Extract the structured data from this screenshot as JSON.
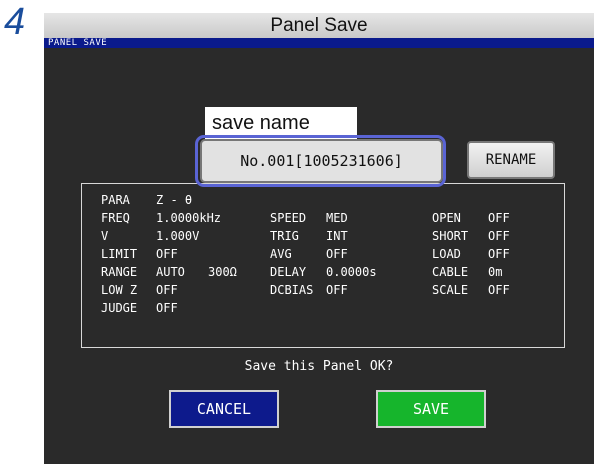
{
  "step_number": "4",
  "header_title": "Panel Save",
  "screen_title": "PANEL SAVE",
  "callout_label": "save name",
  "save_name": {
    "number": "No.001",
    "bracket_open": "[",
    "value": "1005231606",
    "bracket_close": "]"
  },
  "rename_label": "RENAME",
  "params": {
    "para": {
      "label": "PARA",
      "value": "Z - θ"
    },
    "freq": {
      "label": "FREQ",
      "value": "1.0000kHz"
    },
    "v": {
      "label": "V",
      "value": "1.000V"
    },
    "limit": {
      "label": "LIMIT",
      "value": "OFF"
    },
    "range": {
      "label": "RANGE",
      "value": "AUTO",
      "value2": "300Ω"
    },
    "lowz": {
      "label": "LOW Z",
      "value": "OFF"
    },
    "judge": {
      "label": "JUDGE",
      "value": "OFF"
    },
    "speed": {
      "label": "SPEED",
      "value": "MED"
    },
    "trig": {
      "label": "TRIG",
      "value": "INT"
    },
    "avg": {
      "label": "AVG",
      "value": "OFF"
    },
    "delay": {
      "label": "DELAY",
      "value": "0.0000s"
    },
    "dcbias": {
      "label": "DCBIAS",
      "value": "OFF"
    },
    "open": {
      "label": "OPEN",
      "value": "OFF"
    },
    "short": {
      "label": "SHORT",
      "value": "OFF"
    },
    "load": {
      "label": "LOAD",
      "value": "OFF"
    },
    "cable": {
      "label": "CABLE",
      "value": "0m"
    },
    "scale": {
      "label": "SCALE",
      "value": "OFF"
    }
  },
  "prompt": "Save this Panel OK?",
  "cancel_label": "CANCEL",
  "save_label": "SAVE"
}
